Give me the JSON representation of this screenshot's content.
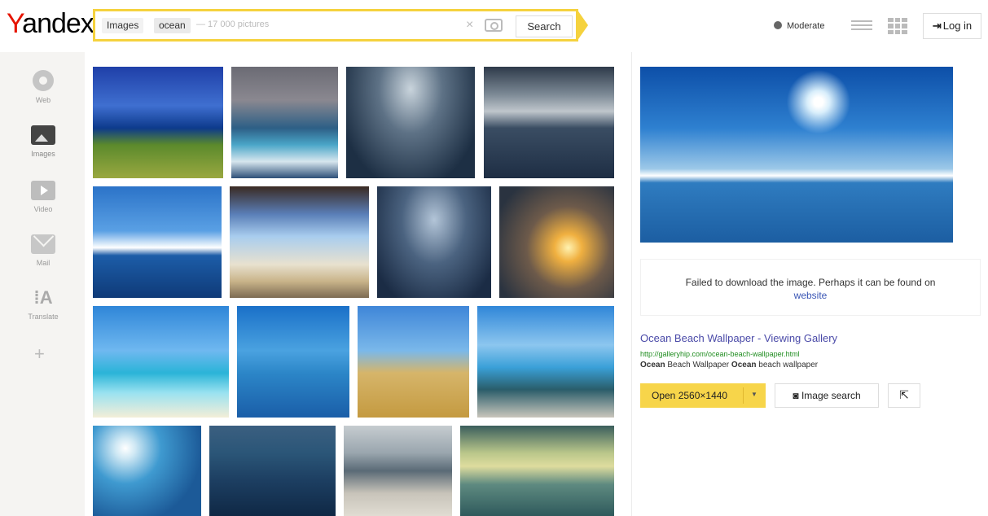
{
  "header": {
    "logo_first": "Y",
    "logo_rest": "andex",
    "search": {
      "tag_images": "Images",
      "query": "ocean",
      "hint": "— 17 000 pictures",
      "clear_glyph": "×",
      "button_label": "Search"
    },
    "moderate_label": "Moderate",
    "login_label": "Log in"
  },
  "sidebar": {
    "items": [
      {
        "label": "Web",
        "icon": "search-icon"
      },
      {
        "label": "Images",
        "icon": "image-icon"
      },
      {
        "label": "Video",
        "icon": "video-icon"
      },
      {
        "label": "Mail",
        "icon": "mail-icon"
      },
      {
        "label": "Translate",
        "icon": "translate-icon"
      }
    ],
    "more_glyph": "+"
  },
  "grid": {
    "tile_count": 16
  },
  "preview": {
    "failed_text": "Failed to download the image. Perhaps it can be found on",
    "failed_link": "website",
    "result": {
      "title": "Ocean Beach Wallpaper - Viewing Gallery",
      "url": "http://galleryhip.com/ocean-beach-wallpaper.html",
      "desc_bold_1": "Ocean",
      "desc_mid_1": " Beach Wallpaper ",
      "desc_bold_2": "Ocean",
      "desc_end": " beach wallpaper"
    },
    "open_label": "Open 2560×1440",
    "image_search_label": "Image search",
    "translate_glyph": "⁞A"
  },
  "colors": {
    "accent_yellow": "#f5d23e",
    "button_yellow": "#f7d54a",
    "link_blue": "#4a4aa8",
    "url_green": "#1e8c1e",
    "logo_red": "#e61400"
  }
}
